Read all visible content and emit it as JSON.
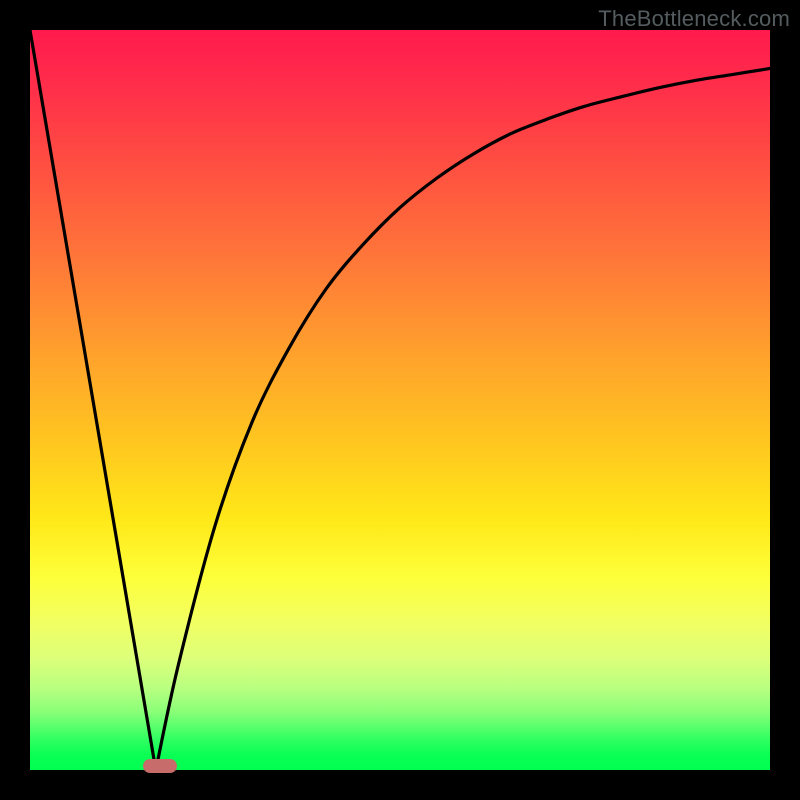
{
  "credit": "TheBottleneck.com",
  "chart_data": {
    "type": "line",
    "title": "",
    "xlabel": "",
    "ylabel": "",
    "xlim": [
      0,
      100
    ],
    "ylim": [
      0,
      100
    ],
    "grid": false,
    "series": [
      {
        "name": "left-slope",
        "x": [
          0,
          17
        ],
        "values": [
          100,
          0
        ]
      },
      {
        "name": "right-curve",
        "x": [
          17,
          20,
          25,
          30,
          35,
          40,
          45,
          50,
          55,
          60,
          65,
          70,
          75,
          80,
          85,
          90,
          95,
          100
        ],
        "values": [
          0,
          14,
          33,
          47,
          57,
          65,
          71,
          76,
          80,
          83.3,
          86,
          88,
          89.7,
          91,
          92.2,
          93.2,
          94,
          94.8
        ]
      }
    ],
    "annotations": [
      {
        "type": "marker",
        "x": 17.5,
        "y": 0,
        "shape": "pill",
        "color": "#c76b6b"
      }
    ]
  },
  "colors": {
    "curve": "#000000",
    "background_border": "#000000"
  }
}
